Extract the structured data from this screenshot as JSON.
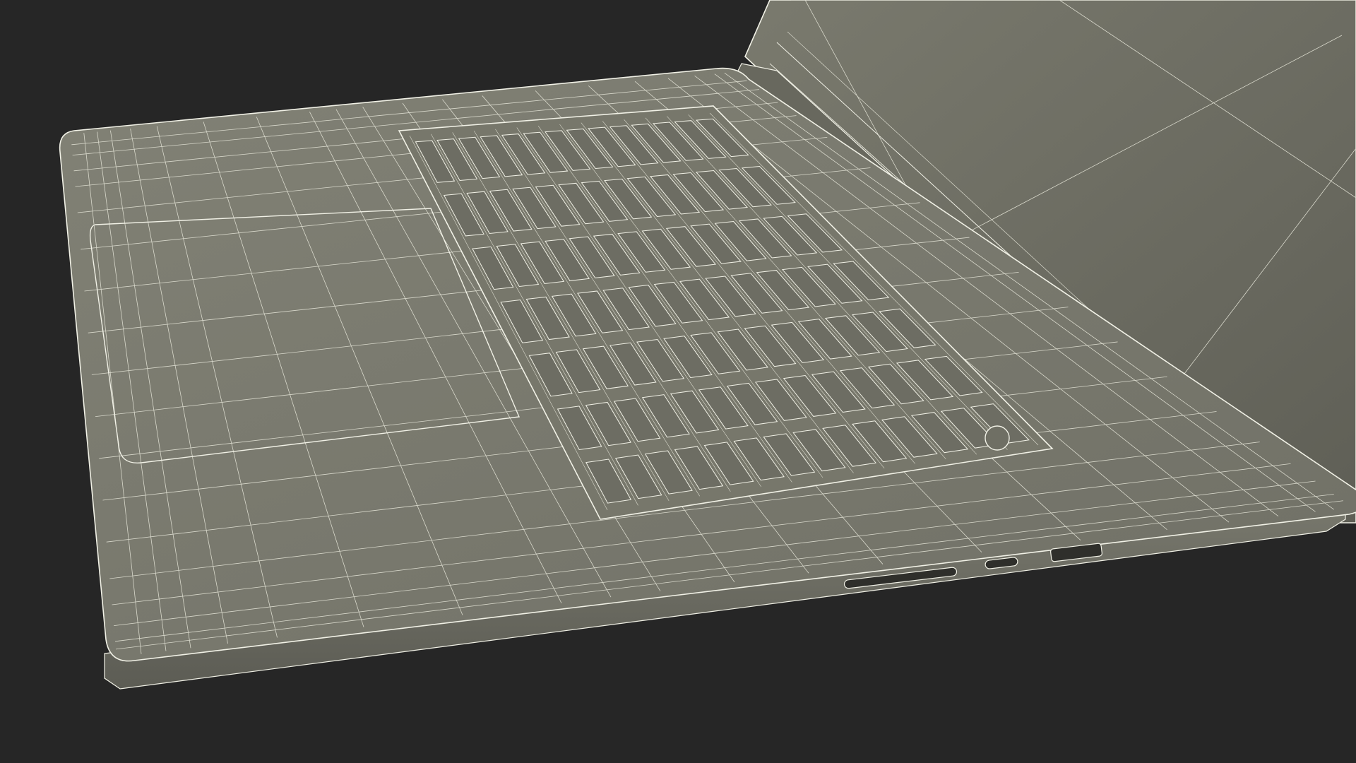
{
  "scene": {
    "subject": "laptop-wireframe-render",
    "colors": {
      "background": "#262626",
      "surface": "#7b7b6f",
      "surface_dark": "#6a6a60",
      "screen": "#6e6e63",
      "wire": "#f1f1e6",
      "wire_faint": "#d9d9cc",
      "edge_shadow": "#3a3a35"
    },
    "parts": {
      "keyboard_rows": 7,
      "keyboard_cols": 14,
      "ports": [
        "sd-card-slot",
        "usb-c-port",
        "hdmi-port"
      ]
    }
  }
}
